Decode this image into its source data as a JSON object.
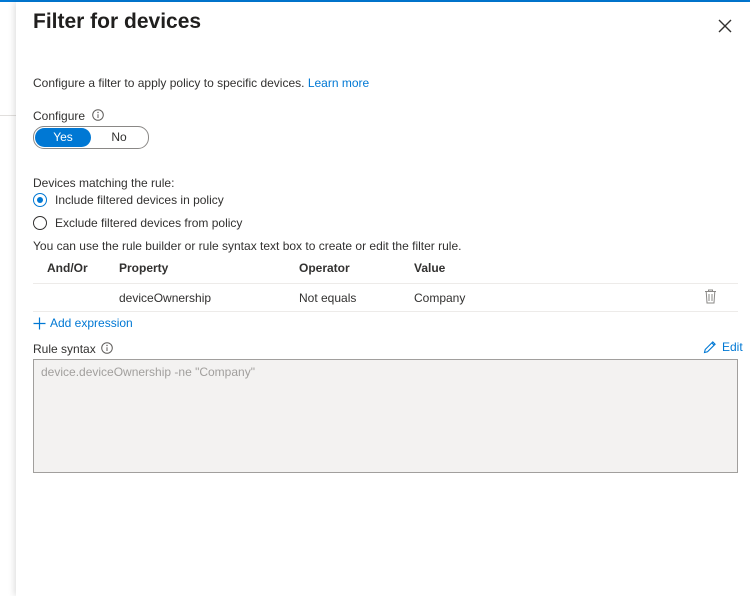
{
  "panel": {
    "title": "Filter for devices",
    "description": "Configure a filter to apply policy to specific devices.",
    "learn_more": "Learn more"
  },
  "configure": {
    "label": "Configure",
    "options": [
      "Yes",
      "No"
    ],
    "selected": "Yes"
  },
  "matching": {
    "label": "Devices matching the rule:",
    "options": [
      "Include filtered devices in policy",
      "Exclude filtered devices from policy"
    ],
    "selected": "Include filtered devices in policy"
  },
  "builder_hint": "You can use the rule builder or rule syntax text box to create or edit the filter rule.",
  "table": {
    "headers": [
      "And/Or",
      "Property",
      "Operator",
      "Value"
    ],
    "rows": [
      {
        "andor": "",
        "property": "deviceOwnership",
        "operator": "Not equals",
        "value": "Company"
      }
    ]
  },
  "add_expression": "Add expression",
  "rule_syntax": {
    "label": "Rule syntax",
    "edit": "Edit",
    "value": "device.deviceOwnership -ne \"Company\""
  },
  "colors": {
    "accent": "#0078d4",
    "text": "#323130",
    "textbox_bg": "#f3f2f1"
  },
  "icons": [
    "close-icon",
    "info-icon",
    "delete-icon",
    "add-icon",
    "edit-icon"
  ]
}
